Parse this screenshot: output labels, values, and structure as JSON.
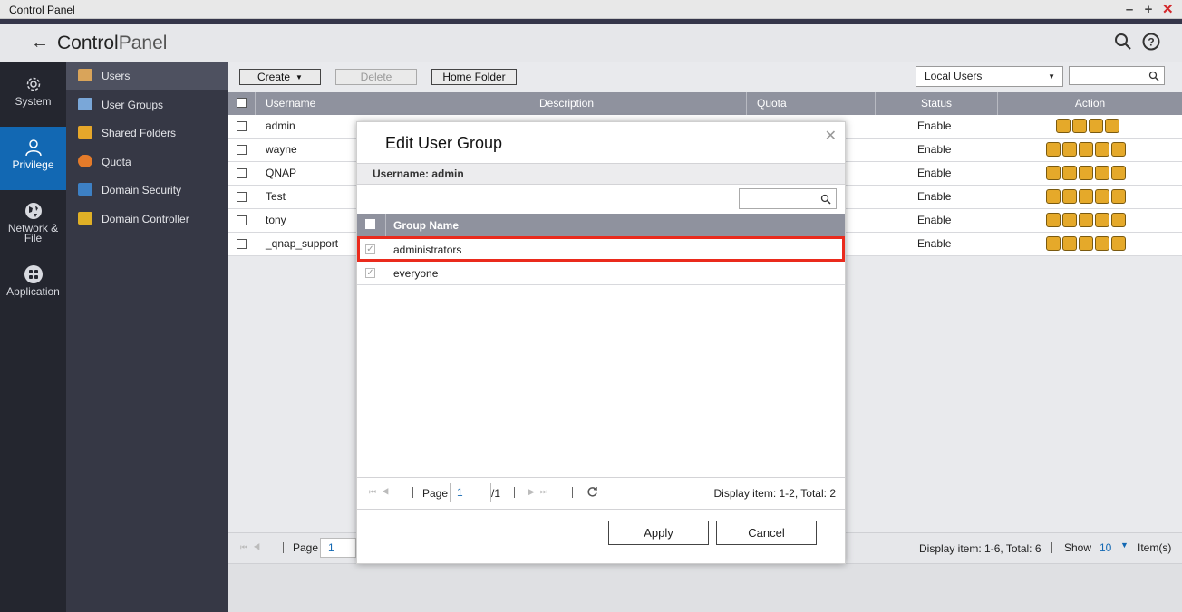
{
  "window": {
    "title": "Control Panel"
  },
  "header": {
    "title_bold": "Control",
    "title_rest": "Panel"
  },
  "leftbar": [
    {
      "label": "System",
      "icon": "gear-icon"
    },
    {
      "label": "Privilege",
      "icon": "user-icon"
    },
    {
      "label": "Network &",
      "label2": "File",
      "icon": "globe-icon"
    },
    {
      "label": "Application",
      "icon": "grid-icon"
    }
  ],
  "subnav": [
    {
      "label": "Users",
      "icon": "user-icon",
      "color": "#d9a45a"
    },
    {
      "label": "User Groups",
      "icon": "users-icon",
      "color": "#7aa7d8"
    },
    {
      "label": "Shared Folders",
      "icon": "folder-icon",
      "color": "#e6a72a"
    },
    {
      "label": "Quota",
      "icon": "pie-icon",
      "color": "#e47b2a"
    },
    {
      "label": "Domain Security",
      "icon": "domain-icon",
      "color": "#3d80c4"
    },
    {
      "label": "Domain Controller",
      "icon": "controller-icon",
      "color": "#e0b026"
    }
  ],
  "toolbar": {
    "create_label": "Create",
    "delete_label": "Delete",
    "home_folder_label": "Home Folder",
    "user_type_selected": "Local Users"
  },
  "grid": {
    "columns": [
      "Username",
      "Description",
      "Quota",
      "Status",
      "Action"
    ],
    "rows": [
      {
        "username": "admin",
        "status": "Enable",
        "actions": 4
      },
      {
        "username": "wayne",
        "status": "Enable",
        "actions": 5
      },
      {
        "username": "QNAP",
        "status": "Enable",
        "actions": 5
      },
      {
        "username": "Test",
        "status": "Enable",
        "actions": 5
      },
      {
        "username": "tony",
        "status": "Enable",
        "actions": 5
      },
      {
        "username": "_qnap_support",
        "status": "Enable",
        "actions": 5
      }
    ]
  },
  "pager": {
    "page_label": "Page",
    "page_value": "1",
    "display_text": "Display item: 1-6, Total: 6",
    "show_label": "Show",
    "show_value": "10",
    "items_label": "Item(s)"
  },
  "dialog": {
    "title": "Edit User Group",
    "username_line": "Username: admin",
    "column_header": "Group Name",
    "groups": [
      {
        "name": "administrators",
        "checked": true
      },
      {
        "name": "everyone",
        "checked": true
      }
    ],
    "page_label": "Page",
    "page_value": "1",
    "page_total": "/1",
    "display_text": "Display item: 1-2, Total: 2",
    "apply_label": "Apply",
    "cancel_label": "Cancel"
  },
  "colors": {
    "accent": "#1268b3",
    "highlight": "#ea2a1c",
    "close": "#d3282b"
  }
}
